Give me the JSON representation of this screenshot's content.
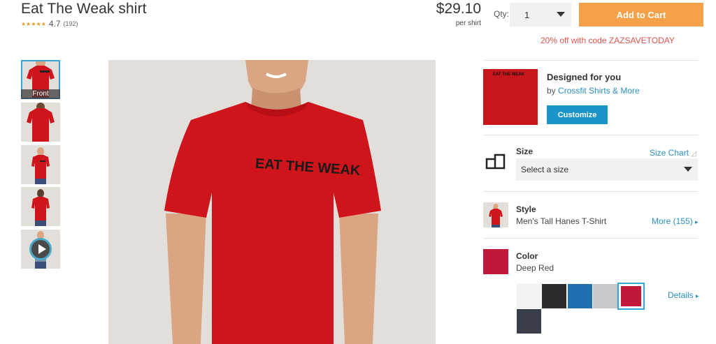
{
  "product": {
    "title": "Eat The Weak shirt",
    "stars": "★★★★★",
    "rating": "4.7",
    "review_count": "(192)",
    "price": "$29.10",
    "price_unit": "per shirt"
  },
  "cart": {
    "qty_label": "Qty:",
    "qty_value": "1",
    "add_to_cart_label": "Add to Cart",
    "promo_text": "20% off with code ZAZSAVETODAY"
  },
  "thumbnails": [
    {
      "label": "Front"
    }
  ],
  "main_image": {
    "shirt_print": "EAT THE WEAK"
  },
  "design": {
    "thumb_print": "EAT THE WEAK",
    "title": "Designed for you",
    "by_prefix": "by",
    "by_link": "Crossfit Shirts & More",
    "customize_label": "Customize"
  },
  "size": {
    "label": "Size",
    "chart_link": "Size Chart",
    "placeholder": "Select a size"
  },
  "style": {
    "label": "Style",
    "value": "Men's Tall Hanes T-Shirt",
    "more_link": "More (155)"
  },
  "color": {
    "label": "Color",
    "value": "Deep Red",
    "selected_hex": "#c0183a",
    "swatches": [
      "#f2f2f2",
      "#2b2b2b",
      "#1f6fb3",
      "#c8c8cc",
      "#c0183a",
      "#3a3d4a"
    ],
    "details_link": "Details"
  }
}
